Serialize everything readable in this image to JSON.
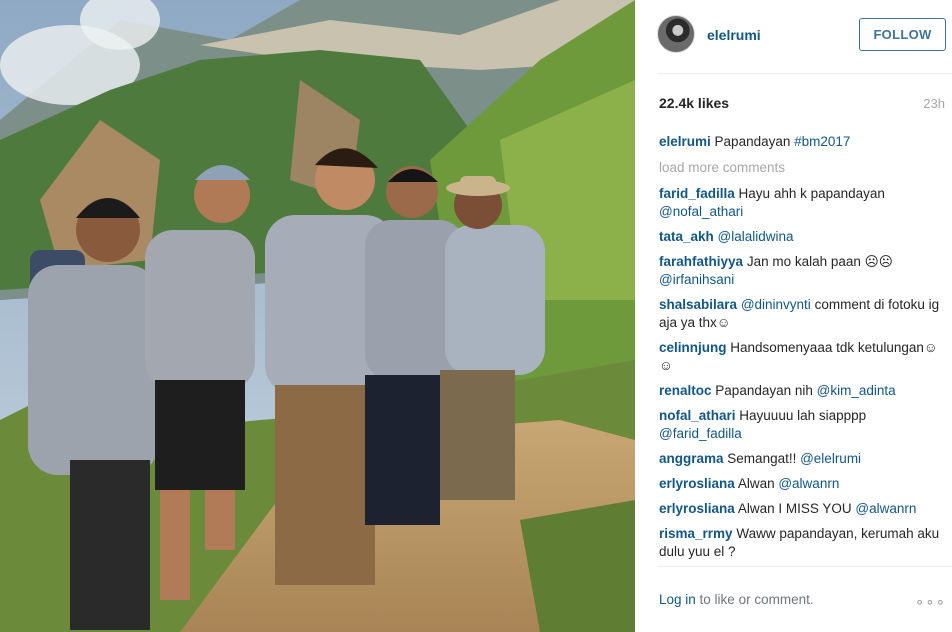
{
  "photo": {
    "alt_icon": "hikers-photo"
  },
  "header": {
    "username": "elelrumi",
    "follow_label": "FOLLOW"
  },
  "stats": {
    "likes": "22.4k likes",
    "time_ago": "23h"
  },
  "caption": {
    "user": "elelrumi",
    "text": "Papandayan ",
    "hashtag": "#bm2017"
  },
  "load_more": "load more comments",
  "comments": [
    {
      "user": "farid_fadilla",
      "text": "Hayu ahh k papandayan ",
      "mention": "@nofal_athari"
    },
    {
      "user": "tata_akh",
      "text": "",
      "mention": "@lalalidwina"
    },
    {
      "user": "farahfathiyya",
      "text": "Jan mo kalah paan ☹☹",
      "mention": "@irfanihsani"
    },
    {
      "user": "shalsabilara",
      "text": "",
      "mention": "@dininvynti",
      "after": "  comment di fotoku ig aja ya thx☺"
    },
    {
      "user": "celinnjung",
      "text": "Handsomenyaaa tdk ketulungan☺☺",
      "mention": ""
    },
    {
      "user": "renaltoc",
      "text": "Papandayan nih ",
      "mention": "@kim_adinta"
    },
    {
      "user": "nofal_athari",
      "text": "Hayuuuu lah siapppp ",
      "mention": "@farid_fadilla"
    },
    {
      "user": "anggrama",
      "text": "Semangat!! ",
      "mention": "@elelrumi"
    },
    {
      "user": "erlyrosliana",
      "text": "Alwan ",
      "mention": "@alwanrn"
    },
    {
      "user": "erlyrosliana",
      "text": "Alwan I MISS YOU ",
      "mention": "@alwanrn"
    },
    {
      "user": "risma_rrmy",
      "text": "Waww papandayan, kerumah aku dulu yuu el ?",
      "mention": ""
    }
  ],
  "footer": {
    "login_label": "Log in",
    "login_rest": " to like or comment.",
    "more_icon": "more-options-icon",
    "more_glyph": "∘∘∘"
  },
  "colors": {
    "link": "#125688",
    "follow": "#3f729b",
    "muted": "#a5a7aa"
  }
}
